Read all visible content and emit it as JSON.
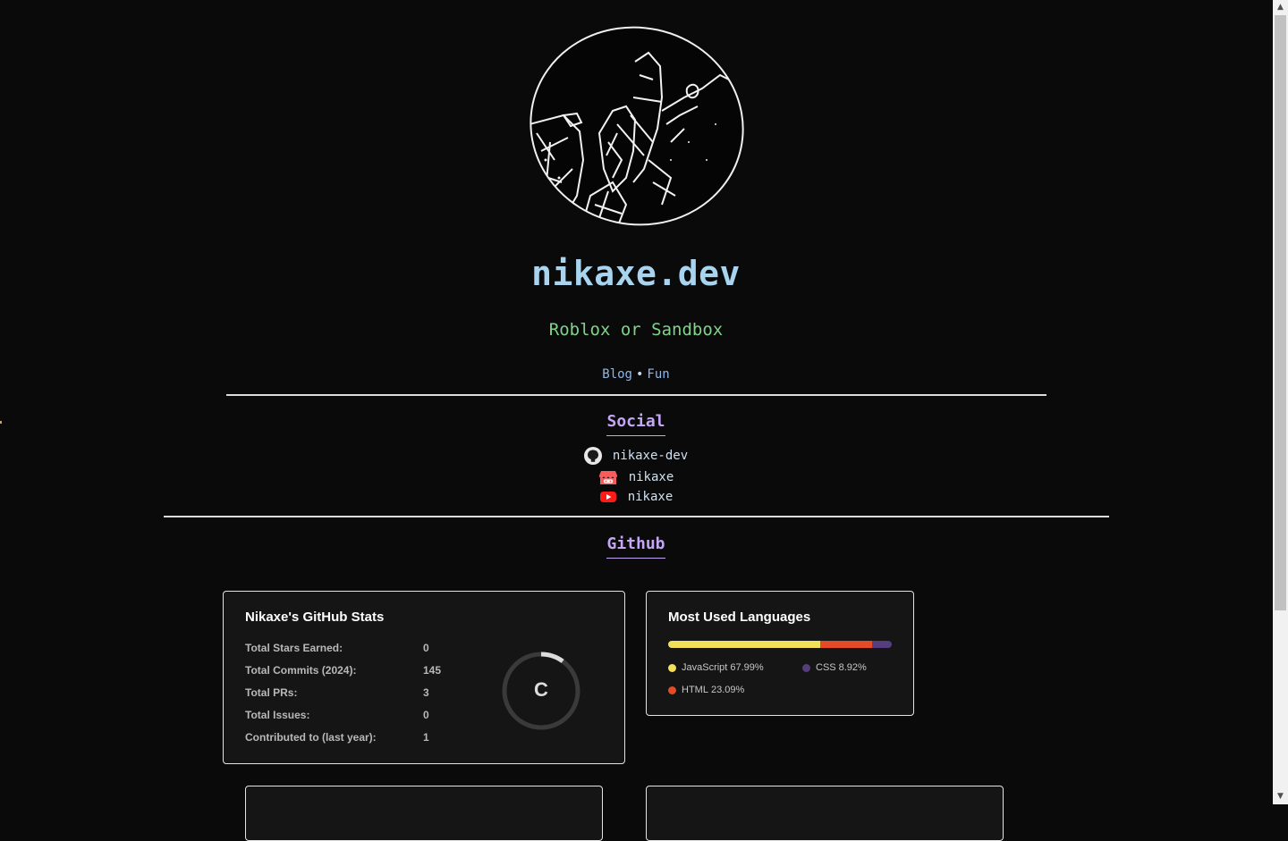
{
  "site": {
    "title": "nikaxe.dev",
    "subtitle": "Roblox or Sandbox",
    "nav": [
      {
        "label": "Blog"
      },
      {
        "separator": "•"
      },
      {
        "label": "Fun"
      }
    ]
  },
  "social": {
    "title": "Social",
    "links": [
      {
        "icon": "github-icon",
        "label": "nikaxe-dev"
      },
      {
        "icon": "itchio-icon",
        "label": "nikaxe"
      },
      {
        "icon": "youtube-icon",
        "label": "nikaxe"
      }
    ]
  },
  "github": {
    "title": "Github",
    "stats_card": {
      "title": "Nikaxe's GitHub Stats",
      "rows": [
        {
          "label": "Total Stars Earned:",
          "value": "0"
        },
        {
          "label": "Total Commits (2024):",
          "value": "145"
        },
        {
          "label": "Total PRs:",
          "value": "3"
        },
        {
          "label": "Total Issues:",
          "value": "0"
        },
        {
          "label": "Contributed to (last year):",
          "value": "1"
        }
      ],
      "rank": "C",
      "rank_ring_fill": 0.1
    },
    "languages_card": {
      "title": "Most Used Languages",
      "languages": [
        {
          "name": "JavaScript",
          "percent": "67.99%",
          "value": 67.99,
          "color": "#f1e05a"
        },
        {
          "name": "HTML",
          "percent": "23.09%",
          "value": 23.09,
          "color": "#e34c26"
        },
        {
          "name": "CSS",
          "percent": "8.92%",
          "value": 8.92,
          "color": "#563d7c"
        }
      ]
    }
  },
  "colors": {
    "background": "#0a0a0a",
    "title": "#a9d4ef",
    "subtitle": "#7fd48a",
    "link": "#8fb8e8",
    "section_heading": "#c4a6f5",
    "card_bg": "#151515"
  }
}
